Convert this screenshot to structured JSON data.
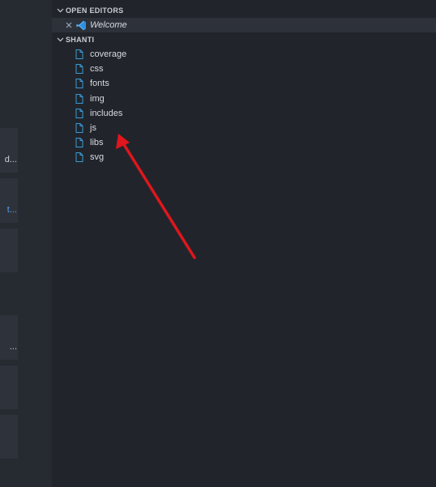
{
  "left_panel": {
    "cards": [
      {
        "text": "d..."
      },
      {
        "text": "t...",
        "link": true
      },
      {
        "text": ""
      },
      {
        "text": "..."
      },
      {
        "text": ""
      },
      {
        "text": ""
      }
    ]
  },
  "explorer": {
    "open_editors": {
      "title": "OPEN EDITORS",
      "items": [
        {
          "label": "Welcome"
        }
      ]
    },
    "folder": {
      "title": "SHANTI",
      "items": [
        "coverage",
        "css",
        "fonts",
        "img",
        "includes",
        "js",
        "libs",
        "svg"
      ]
    }
  },
  "annotation": {
    "color": "#e0161c",
    "target": "js"
  },
  "colors": {
    "sidebar_bg": "#21252b",
    "selection_bg": "#2c313a",
    "file_icon": "#3c9ad6",
    "text": "#d7dae0"
  },
  "icons": {
    "chevron": "chevron-down-icon",
    "close": "close-icon",
    "vscode": "vscode-icon",
    "file": "file-icon"
  }
}
